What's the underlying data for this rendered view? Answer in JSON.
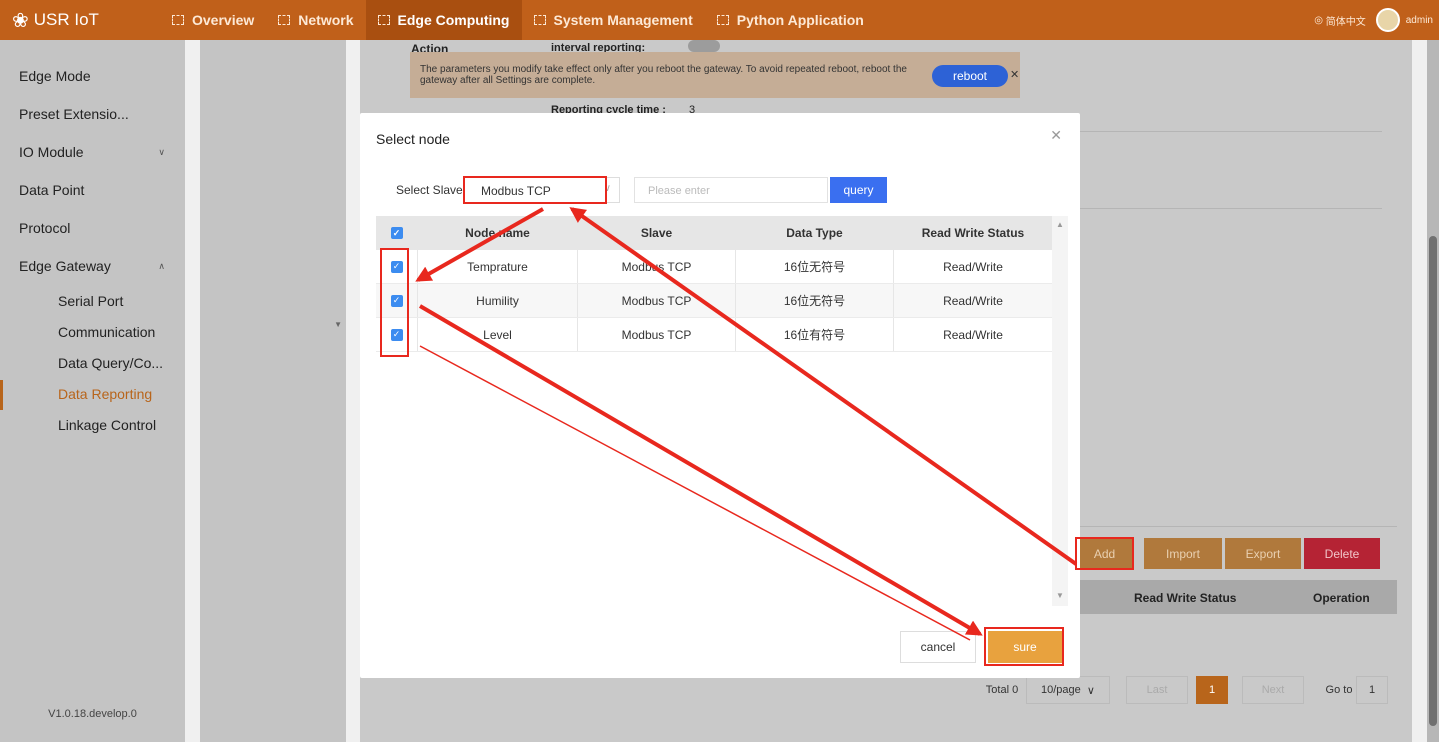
{
  "app": {
    "logo_text": "USR IoT"
  },
  "nav": {
    "items": [
      {
        "label": "Overview"
      },
      {
        "label": "Network"
      },
      {
        "label": "Edge Computing"
      },
      {
        "label": "System Management"
      },
      {
        "label": "Python Application"
      }
    ],
    "active": "Edge Computing",
    "language": "简体中文",
    "user": "admin"
  },
  "sidebar": {
    "items": [
      "Edge Mode",
      "Preset Extensio...",
      "IO Module",
      "Data Point",
      "Protocol",
      "Edge Gateway"
    ],
    "sub_items": [
      "Serial Port",
      "Communication",
      "Data Query/Co...",
      "Data Reporting",
      "Linkage Control"
    ],
    "active": "Data Reporting",
    "version": "V1.0.18.develop.0"
  },
  "background": {
    "action_label": "Action",
    "interval_label": "interval reporting:",
    "notice": "The parameters you modify take effect only after you reboot the gateway. To avoid repeated reboot, reboot the gateway after all Settings are complete.",
    "reboot_label": "reboot",
    "cycle_label": "Reporting cycle time :",
    "cycle_value": "3",
    "buttons": {
      "add": "Add",
      "import": "Import",
      "export": "Export",
      "delete": "Delete"
    },
    "table_headers": {
      "status": "Read Write Status",
      "operation": "Operation"
    },
    "pager": {
      "total": "Total 0",
      "per_page": "10/page",
      "last": "Last",
      "page": "1",
      "next": "Next",
      "goto_label": "Go to",
      "goto_value": "1"
    }
  },
  "modal": {
    "title": "Select node",
    "slave_label": "Select Slave:",
    "slave_value": "Modbus TCP",
    "search_placeholder": "Please enter",
    "query_label": "query",
    "headers": {
      "node": "Node name",
      "slave": "Slave",
      "type": "Data Type",
      "status": "Read Write Status"
    },
    "rows": [
      {
        "node": "Temprature",
        "slave": "Modbus TCP",
        "type": "16位无符号",
        "status": "Read/Write",
        "checked": true
      },
      {
        "node": "Humility",
        "slave": "Modbus TCP",
        "type": "16位无符号",
        "status": "Read/Write",
        "checked": true
      },
      {
        "node": "Level",
        "slave": "Modbus TCP",
        "type": "16位有符号",
        "status": "Read/Write",
        "checked": true
      }
    ],
    "cancel_label": "cancel",
    "sure_label": "sure"
  },
  "colors": {
    "topbar": "#c0601a",
    "accent": "#b8651b",
    "annotation": "#e8281e",
    "primary_blue": "#3a6ff0",
    "sure": "#e8a23e"
  }
}
